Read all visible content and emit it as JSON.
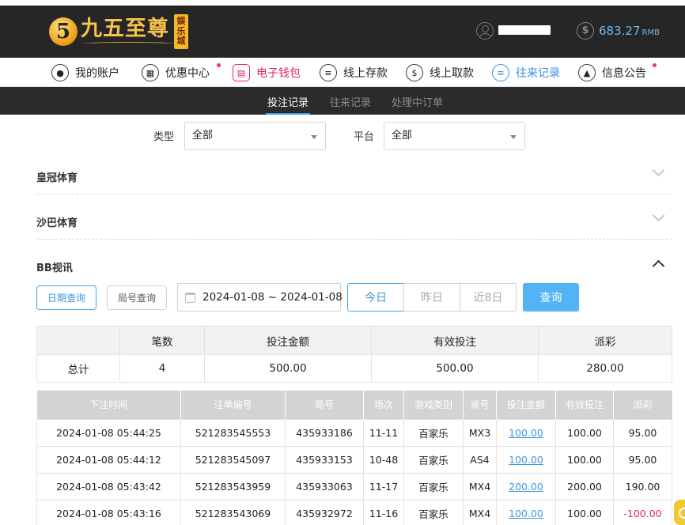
{
  "brand": {
    "logo_mark": "5",
    "name": "九五至尊",
    "badge": [
      "娱",
      "乐",
      "城"
    ]
  },
  "account": {
    "username": "",
    "balance": "683.27",
    "currency": "RMB"
  },
  "main_nav": [
    {
      "label": "我的账户",
      "icon": "user-circle-icon"
    },
    {
      "label": "优惠中心",
      "icon": "gift-icon"
    },
    {
      "label": "电子钱包",
      "icon": "wallet-icon"
    },
    {
      "label": "线上存款",
      "icon": "deposit-icon"
    },
    {
      "label": "线上取款",
      "icon": "withdraw-icon"
    },
    {
      "label": "往来记录",
      "icon": "records-icon"
    },
    {
      "label": "信息公告",
      "icon": "bell-icon"
    }
  ],
  "sub_tabs": [
    "投注记录",
    "往来记录",
    "处理中订单"
  ],
  "filters": {
    "type_label": "类型",
    "type_value": "全部",
    "platform_label": "平台",
    "platform_value": "全部"
  },
  "sections": [
    "皇冠体育",
    "沙巴体育",
    "BB视讯"
  ],
  "query": {
    "date_query": "日期查询",
    "round_query": "局号查询",
    "date_range": "2024-01-08 ~ 2024-01-08",
    "today": "今日",
    "yesterday": "昨日",
    "last8": "近8日",
    "submit": "查询"
  },
  "summary": {
    "headers": [
      "",
      "笔数",
      "投注金额",
      "有效投注",
      "派彩"
    ],
    "row": [
      "总计",
      "4",
      "500.00",
      "500.00",
      "280.00"
    ]
  },
  "detail": {
    "headers": [
      "下注时间",
      "注单编号",
      "局号",
      "场次",
      "游戏类别",
      "桌号",
      "投注金额",
      "有效投注",
      "派彩"
    ],
    "rows": [
      [
        "2024-01-08 05:44:25",
        "521283545553",
        "435933186",
        "11-11",
        "百家乐",
        "MX3",
        "100.00",
        "100.00",
        "95.00"
      ],
      [
        "2024-01-08 05:44:12",
        "521283545097",
        "435933153",
        "10-48",
        "百家乐",
        "AS4",
        "100.00",
        "100.00",
        "95.00"
      ],
      [
        "2024-01-08 05:43:42",
        "521283543959",
        "435933063",
        "11-17",
        "百家乐",
        "MX4",
        "200.00",
        "200.00",
        "190.00"
      ],
      [
        "2024-01-08 05:43:16",
        "521283543069",
        "435932972",
        "11-16",
        "百家乐",
        "MX4",
        "100.00",
        "100.00",
        "-100.00"
      ]
    ]
  },
  "colors": {
    "accent_blue": "#3d97df",
    "wallet_red": "#e0245e",
    "header_dark": "#262626",
    "gold": "#f6c24a"
  }
}
